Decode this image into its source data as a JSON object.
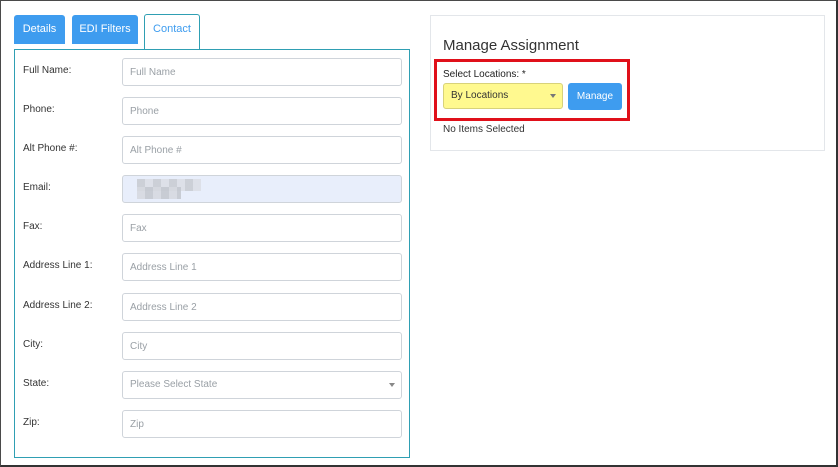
{
  "tabs": [
    {
      "label": "Details",
      "active": false
    },
    {
      "label": "EDI Filters",
      "active": false
    },
    {
      "label": "Contact",
      "active": true
    }
  ],
  "form": {
    "fields": [
      {
        "label": "Full Name:",
        "placeholder": "Full Name",
        "value": ""
      },
      {
        "label": "Phone:",
        "placeholder": "Phone",
        "value": ""
      },
      {
        "label": "Alt Phone #:",
        "placeholder": "Alt Phone #",
        "value": ""
      },
      {
        "label": "Email:",
        "placeholder": "",
        "value": ""
      },
      {
        "label": "Fax:",
        "placeholder": "Fax",
        "value": ""
      },
      {
        "label": "Address Line 1:",
        "placeholder": "Address Line 1",
        "value": ""
      },
      {
        "label": "Address Line 2:",
        "placeholder": "Address Line 2",
        "value": ""
      },
      {
        "label": "City:",
        "placeholder": "City",
        "value": ""
      },
      {
        "label": "State:",
        "selected": "Please Select State"
      },
      {
        "label": "Zip:",
        "placeholder": "Zip",
        "value": ""
      }
    ]
  },
  "assignment": {
    "title": "Manage Assignment",
    "location_label": "Select Locations: *",
    "location_selected": "By Locations",
    "manage_label": "Manage",
    "empty_text": "No Items Selected"
  },
  "colors": {
    "accent": "#3e9cef",
    "panel_border": "#2f9fb3",
    "highlight": "#e0101a",
    "select_highlight": "#fff98f"
  }
}
